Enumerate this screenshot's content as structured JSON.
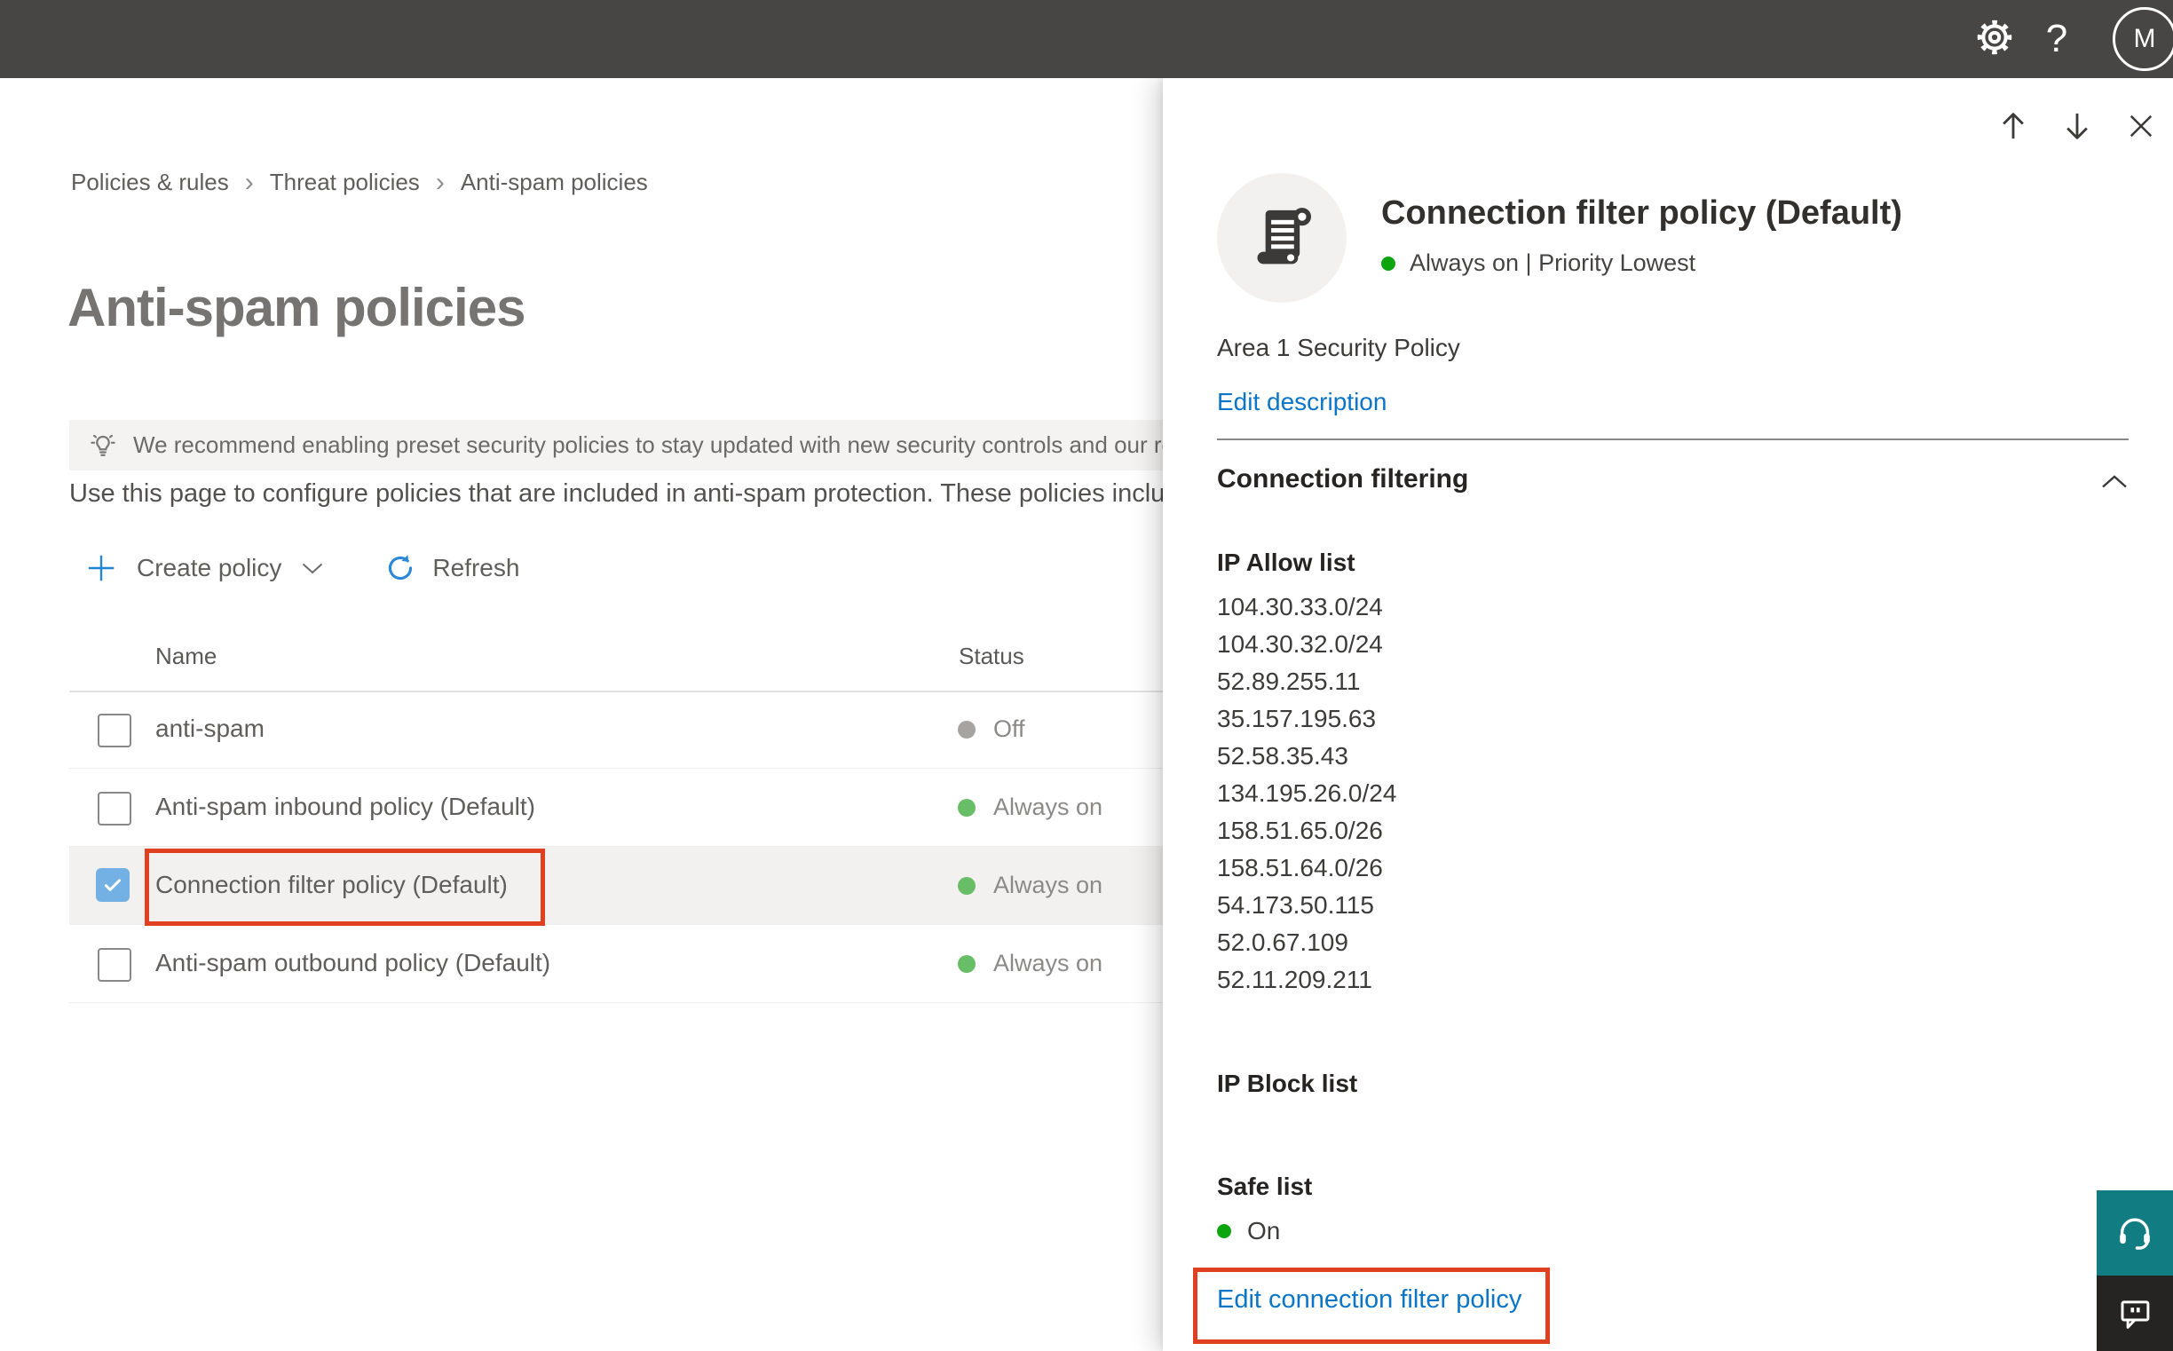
{
  "colors": {
    "topbar-bg": "#484644",
    "link-blue": "#0b76c8",
    "annotation-red": "#e0401f",
    "checkbox-blue": "#73b1e4",
    "status-green-table": "#67be66",
    "status-green-flyout": "#0da50d",
    "status-gray-off": "#a6a4a2",
    "teal-help": "#117d82",
    "feedback-dark": "#252423"
  },
  "topbar": {
    "avatar_initial": "M",
    "help_glyph": "?"
  },
  "breadcrumb": {
    "separator": "›",
    "items": [
      "Policies & rules",
      "Threat policies",
      "Anti-spam policies"
    ]
  },
  "page": {
    "title": "Anti-spam policies",
    "banner_text": "We recommend enabling preset security policies to stay updated with new security controls and our recomme",
    "description": "Use this page to configure policies that are included in anti-spam protection. These policies include"
  },
  "toolbar": {
    "create_policy_label": "Create policy",
    "refresh_label": "Refresh"
  },
  "table": {
    "columns": {
      "name": "Name",
      "status": "Status"
    },
    "rows": [
      {
        "name": "anti-spam",
        "status": "Off"
      },
      {
        "name": "Anti-spam inbound policy (Default)",
        "status": "Always on"
      },
      {
        "name": "Connection filter policy (Default)",
        "status": "Always on"
      },
      {
        "name": "Anti-spam outbound policy (Default)",
        "status": "Always on"
      }
    ]
  },
  "flyout": {
    "title": "Connection filter policy (Default)",
    "status_line": "Always on | Priority Lowest",
    "policy_description": "Area 1 Security Policy",
    "edit_description_label": "Edit description",
    "section_title": "Connection filtering",
    "ip_allow_label": "IP Allow list",
    "ip_allow": [
      "104.30.33.0/24",
      "104.30.32.0/24",
      "52.89.255.11",
      "35.157.195.63",
      "52.58.35.43",
      "134.195.26.0/24",
      "158.51.65.0/26",
      "158.51.64.0/26",
      "54.173.50.115",
      "52.0.67.109",
      "52.11.209.211"
    ],
    "ip_block_label": "IP Block list",
    "safe_list_label": "Safe list",
    "safe_list_status": "On",
    "edit_policy_label": "Edit connection filter policy"
  }
}
